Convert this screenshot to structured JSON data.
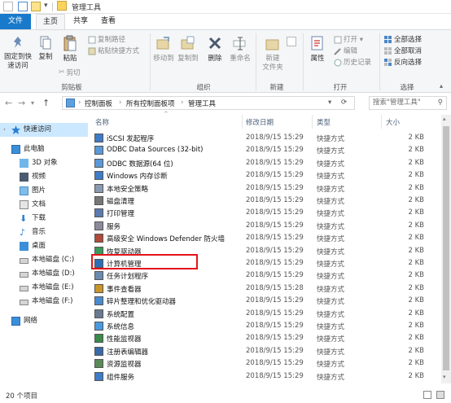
{
  "window": {
    "title": "管理工具"
  },
  "tabs": {
    "file": "文件",
    "home": "主页",
    "share": "共享",
    "view": "查看"
  },
  "ribbon": {
    "clipboard": {
      "pin": "固定到快速访问",
      "copy": "复制",
      "paste": "粘贴",
      "copy_path": "复制路径",
      "paste_shortcut": "粘贴快捷方式",
      "cut": "剪切",
      "label": "剪贴板"
    },
    "organize": {
      "move_to": "移动到",
      "copy_to": "复制到",
      "delete": "删除",
      "rename": "重命名",
      "label": "组织"
    },
    "new": {
      "new_folder_line1": "新建",
      "new_folder_line2": "文件夹",
      "label": "新建"
    },
    "open": {
      "properties": "属性",
      "open": "打开",
      "edit": "编辑",
      "history": "历史记录",
      "label": "打开"
    },
    "select": {
      "select_all": "全部选择",
      "select_none": "全部取消",
      "invert": "反向选择",
      "label": "选择"
    }
  },
  "address": {
    "crumbs": [
      "控制面板",
      "所有控制面板项",
      "管理工具"
    ],
    "search_placeholder": "搜索\"管理工具\""
  },
  "nav": {
    "items": [
      {
        "label": "快速访问",
        "icon": "star-icon"
      },
      {
        "label": "此电脑",
        "icon": "computer-icon"
      },
      {
        "label": "3D 对象",
        "icon": "cube-icon"
      },
      {
        "label": "视频",
        "icon": "video-icon"
      },
      {
        "label": "图片",
        "icon": "picture-icon"
      },
      {
        "label": "文档",
        "icon": "document-icon"
      },
      {
        "label": "下载",
        "icon": "download-icon"
      },
      {
        "label": "音乐",
        "icon": "music-icon"
      },
      {
        "label": "桌面",
        "icon": "desktop-icon"
      },
      {
        "label": "本地磁盘 (C:)",
        "icon": "drive-icon"
      },
      {
        "label": "本地磁盘 (D:)",
        "icon": "drive-icon"
      },
      {
        "label": "本地磁盘 (E:)",
        "icon": "drive-icon"
      },
      {
        "label": "本地磁盘 (F:)",
        "icon": "drive-icon"
      },
      {
        "label": "网络",
        "icon": "network-icon"
      }
    ]
  },
  "columns": {
    "name": "名称",
    "date": "修改日期",
    "type": "类型",
    "size": "大小"
  },
  "files": [
    {
      "name": "iSCSI 发起程序",
      "date": "2018/9/15 15:29",
      "type": "快捷方式",
      "size": "2 KB"
    },
    {
      "name": "ODBC Data Sources (32-bit)",
      "date": "2018/9/15 15:29",
      "type": "快捷方式",
      "size": "2 KB"
    },
    {
      "name": "ODBC 数据源(64 位)",
      "date": "2018/9/15 15:29",
      "type": "快捷方式",
      "size": "2 KB"
    },
    {
      "name": "Windows 内存诊断",
      "date": "2018/9/15 15:29",
      "type": "快捷方式",
      "size": "2 KB"
    },
    {
      "name": "本地安全策略",
      "date": "2018/9/15 15:29",
      "type": "快捷方式",
      "size": "2 KB"
    },
    {
      "name": "磁盘清理",
      "date": "2018/9/15 15:29",
      "type": "快捷方式",
      "size": "2 KB"
    },
    {
      "name": "打印管理",
      "date": "2018/9/15 15:29",
      "type": "快捷方式",
      "size": "2 KB"
    },
    {
      "name": "服务",
      "date": "2018/9/15 15:29",
      "type": "快捷方式",
      "size": "2 KB"
    },
    {
      "name": "高级安全 Windows Defender 防火墙",
      "date": "2018/9/15 15:29",
      "type": "快捷方式",
      "size": "2 KB"
    },
    {
      "name": "恢复驱动器",
      "date": "2018/9/15 15:29",
      "type": "快捷方式",
      "size": "2 KB"
    },
    {
      "name": "计算机管理",
      "date": "2018/9/15 15:29",
      "type": "快捷方式",
      "size": "2 KB"
    },
    {
      "name": "任务计划程序",
      "date": "2018/9/15 15:29",
      "type": "快捷方式",
      "size": "2 KB"
    },
    {
      "name": "事件查看器",
      "date": "2018/9/15 15:28",
      "type": "快捷方式",
      "size": "2 KB"
    },
    {
      "name": "碎片整理和优化驱动器",
      "date": "2018/9/15 15:29",
      "type": "快捷方式",
      "size": "2 KB"
    },
    {
      "name": "系统配置",
      "date": "2018/9/15 15:29",
      "type": "快捷方式",
      "size": "2 KB"
    },
    {
      "name": "系统信息",
      "date": "2018/9/15 15:29",
      "type": "快捷方式",
      "size": "2 KB"
    },
    {
      "name": "性能监视器",
      "date": "2018/9/15 15:29",
      "type": "快捷方式",
      "size": "2 KB"
    },
    {
      "name": "注册表编辑器",
      "date": "2018/9/15 15:29",
      "type": "快捷方式",
      "size": "2 KB"
    },
    {
      "name": "资源监视器",
      "date": "2018/9/15 15:29",
      "type": "快捷方式",
      "size": "2 KB"
    },
    {
      "name": "组件服务",
      "date": "2018/9/15 15:29",
      "type": "快捷方式",
      "size": "2 KB"
    }
  ],
  "status": {
    "count": "20 个项目"
  },
  "colors": {
    "accent": "#1979ca",
    "highlight": "#e4141b",
    "selection": "#cce8ff"
  }
}
